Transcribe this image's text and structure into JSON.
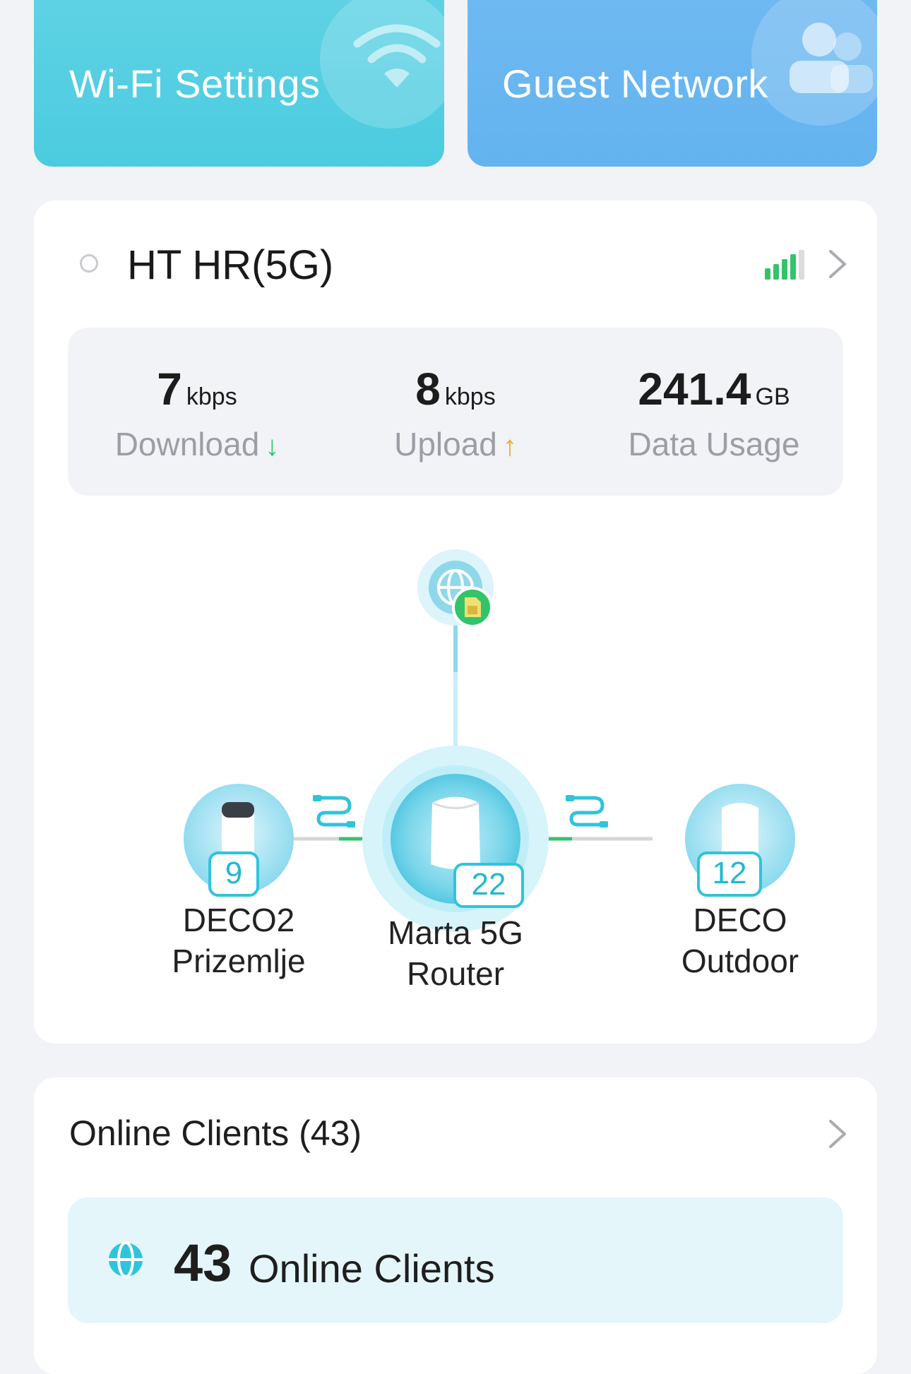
{
  "tiles": {
    "wifi_label": "Wi-Fi Settings",
    "guest_label": "Guest Network"
  },
  "network": {
    "name": "HT HR(5G)",
    "signal_bars_active": 4,
    "signal_bars_total": 5
  },
  "stats": {
    "download": {
      "value": "7",
      "unit": "kbps",
      "label": "Download",
      "arrow": "↓"
    },
    "upload": {
      "value": "8",
      "unit": "kbps",
      "label": "Upload",
      "arrow": "↑"
    },
    "usage": {
      "value": "241.4",
      "unit": "GB",
      "label": "Data Usage"
    }
  },
  "topology": {
    "internet_icon": "globe-sim-icon",
    "main": {
      "name_line1": "Marta 5G",
      "name_line2": "Router",
      "clients": "22"
    },
    "left": {
      "name_line1": "DECO2",
      "name_line2": "Prizemlje",
      "clients": "9"
    },
    "right": {
      "name_line1": "DECO",
      "name_line2": "Outdoor",
      "clients": "12"
    }
  },
  "clients": {
    "title": "Online Clients (43)",
    "count": "43",
    "label": "Online Clients"
  },
  "colors": {
    "wifi_tile": "#5ed2e4",
    "guest_tile": "#6fb9f1",
    "accent": "#2fc4dc",
    "signal": "#33c46a",
    "upload_arrow": "#f4a425"
  }
}
